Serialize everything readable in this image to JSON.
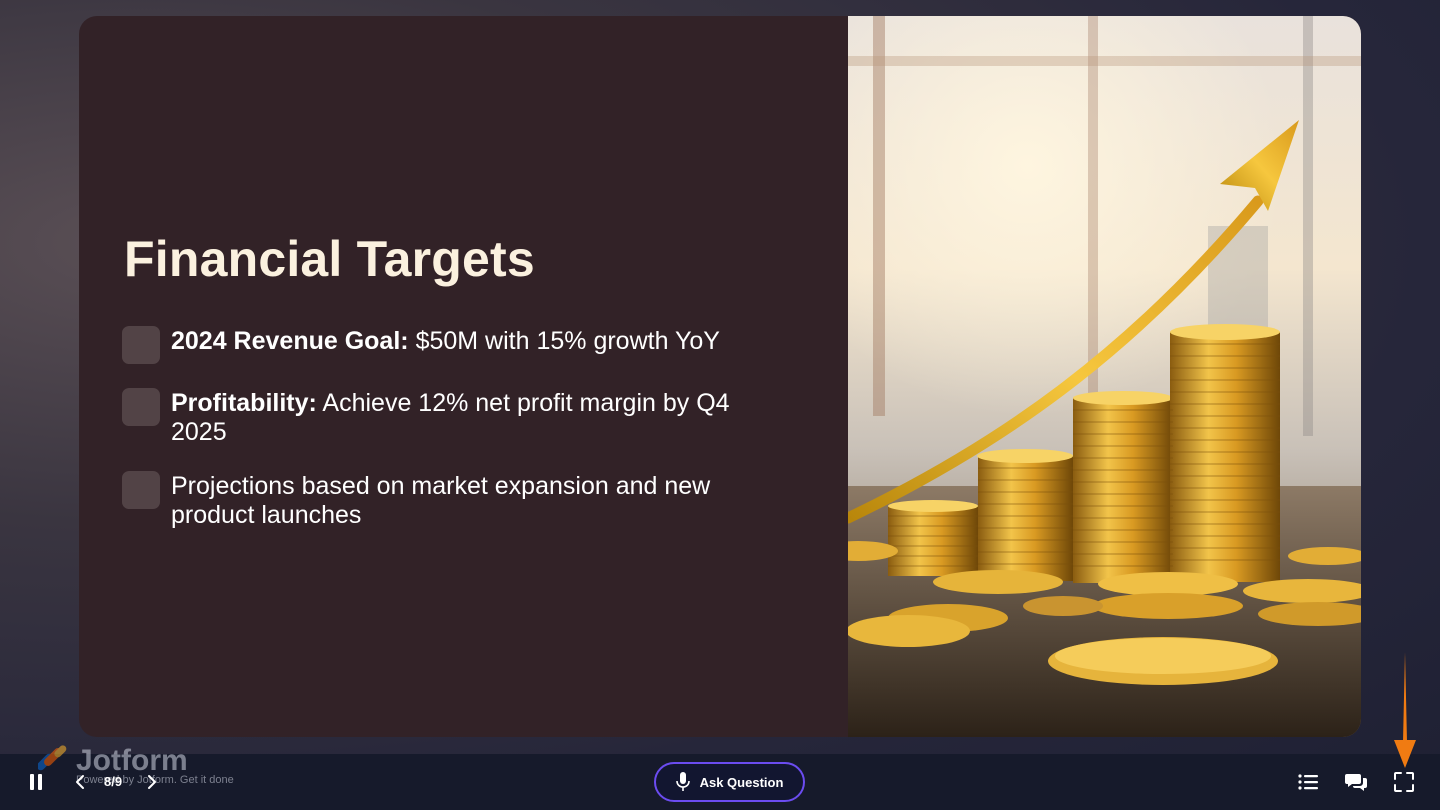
{
  "slide": {
    "title": "Financial Targets",
    "bullets": [
      {
        "bold": "2024 Revenue Goal:",
        "text": " $50M with 15% growth YoY"
      },
      {
        "bold": "Profitability:",
        "text": " Achieve 12% net profit margin by Q4 2025"
      },
      {
        "bold": "",
        "text": "Projections based on market expansion and new product launches"
      }
    ],
    "image_icon": "coins-growth-arrow-illustration"
  },
  "bottombar": {
    "logo_text": "Jotform",
    "logo_tagline": "Powered by Jotform. Get it done",
    "page_counter": "8/9",
    "ask_label": "Ask Question",
    "icons": {
      "pause": "pause-icon",
      "prev": "chevron-left-icon",
      "next": "chevron-right-icon",
      "mic": "microphone-icon",
      "list": "list-icon",
      "chat": "chat-icon",
      "fullscreen": "fullscreen-icon"
    }
  },
  "colors": {
    "slide_bg": "#322227",
    "title": "#fbf1df",
    "accent_border": "#6b4cf0",
    "annotation_arrow": "#f07b12",
    "bar_bg": "#161a2b"
  }
}
